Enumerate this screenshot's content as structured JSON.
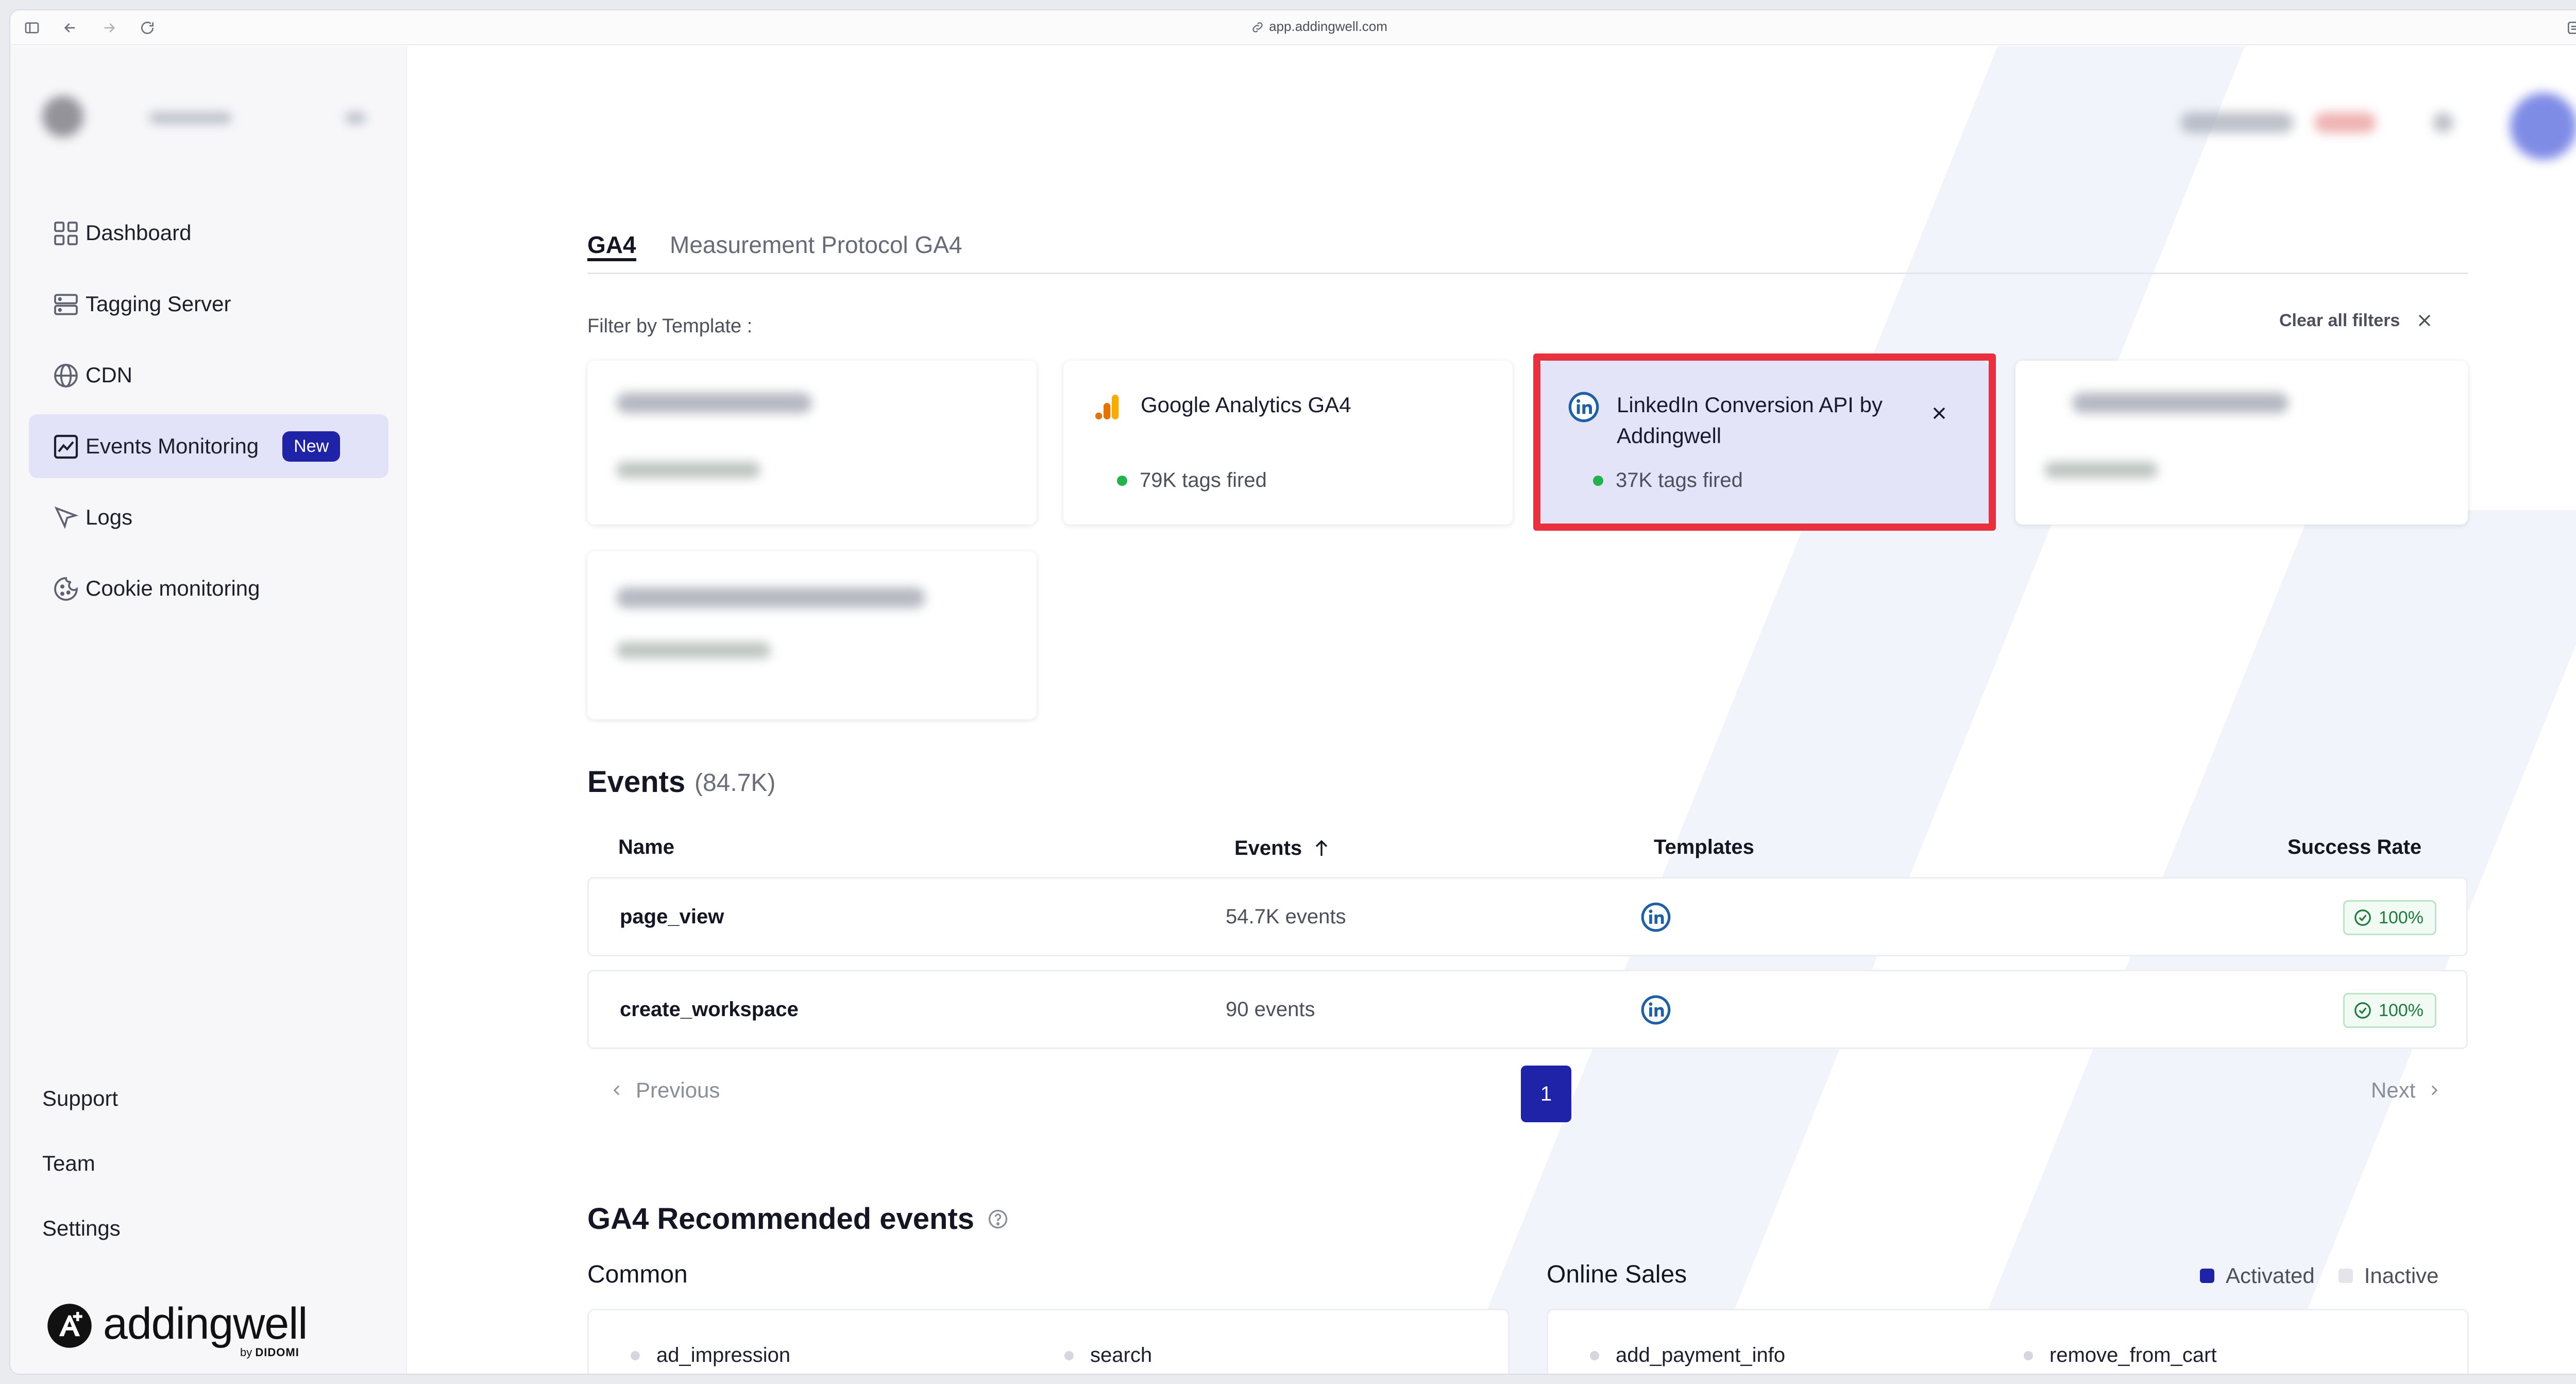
{
  "browser": {
    "url": "app.addingwell.com"
  },
  "sidebar": {
    "items": [
      {
        "label": "Dashboard",
        "icon": "grid-icon"
      },
      {
        "label": "Tagging Server",
        "icon": "server-icon"
      },
      {
        "label": "CDN",
        "icon": "globe-icon"
      },
      {
        "label": "Events Monitoring",
        "icon": "chart-icon",
        "badge": "New",
        "active": true
      },
      {
        "label": "Logs",
        "icon": "cursor-icon"
      },
      {
        "label": "Cookie monitoring",
        "icon": "cookie-icon"
      }
    ],
    "bottom": {
      "support": "Support",
      "team": "Team",
      "settings": "Settings"
    },
    "brand": {
      "name": "addingwell",
      "by": "by",
      "company": "DIDOMI"
    }
  },
  "tabs": {
    "ga4": "GA4",
    "mp": "Measurement Protocol GA4"
  },
  "filters": {
    "label": "Filter by Template :",
    "clear": "Clear all filters",
    "cards": [
      {
        "title": "Google Analytics GA4",
        "tags": "79K tags fired"
      },
      {
        "title_line1": "LinkedIn Conversion API by",
        "title_line2": "Addingwell",
        "tags": "37K tags fired",
        "selected": true
      }
    ]
  },
  "events": {
    "title": "Events",
    "count": "(84.7K)",
    "columns": {
      "name": "Name",
      "events": "Events",
      "templates": "Templates",
      "success": "Success Rate"
    },
    "rows": [
      {
        "name": "page_view",
        "events": "54.7K events",
        "rate": "100%"
      },
      {
        "name": "create_workspace",
        "events": "90 events",
        "rate": "100%"
      }
    ],
    "pager": {
      "prev": "Previous",
      "page": "1",
      "next": "Next"
    }
  },
  "recommended": {
    "title": "GA4 Recommended events",
    "common": {
      "title": "Common",
      "items": [
        "ad_impression",
        "search"
      ]
    },
    "online_sales": {
      "title": "Online Sales",
      "items": [
        "add_payment_info",
        "remove_from_cart"
      ]
    },
    "legend": {
      "activated": "Activated",
      "inactive": "Inactive"
    }
  },
  "colors": {
    "accent": "#1e23a8",
    "highlight": "#e8303f",
    "success": "#23b24b"
  }
}
